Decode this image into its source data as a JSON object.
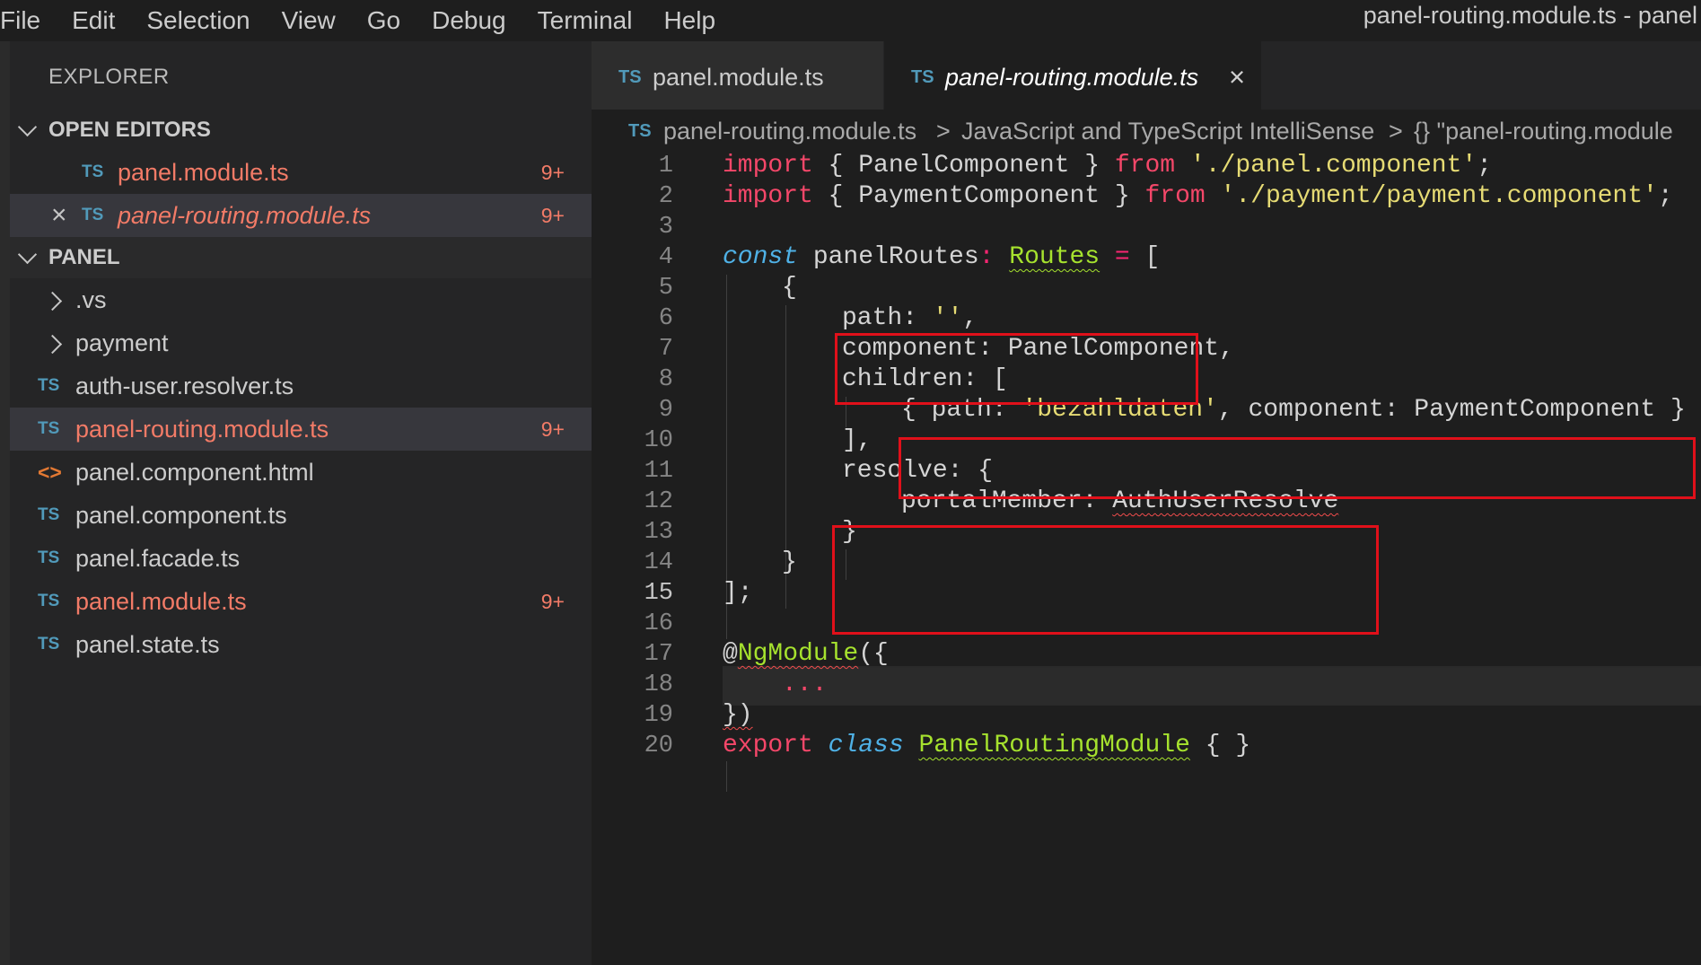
{
  "menu": [
    "File",
    "Edit",
    "Selection",
    "View",
    "Go",
    "Debug",
    "Terminal",
    "Help"
  ],
  "window_title": "panel-routing.module.ts - panel",
  "sidebar": {
    "title": "EXPLORER",
    "open_editors": {
      "header": "OPEN EDITORS",
      "items": [
        {
          "icon": "TS",
          "label": "panel.module.ts",
          "badge": "9+"
        },
        {
          "icon": "TS",
          "label": "panel-routing.module.ts",
          "badge": "9+"
        }
      ]
    },
    "panel": {
      "header": "PANEL",
      "items": [
        {
          "label": ".vs"
        },
        {
          "label": "payment"
        },
        {
          "icon": "TS",
          "label": "auth-user.resolver.ts"
        },
        {
          "icon": "TS",
          "label": "panel-routing.module.ts",
          "badge": "9+"
        },
        {
          "icon": "<>",
          "label": "panel.component.html"
        },
        {
          "icon": "TS",
          "label": "panel.component.ts"
        },
        {
          "icon": "TS",
          "label": "panel.facade.ts"
        },
        {
          "icon": "TS",
          "label": "panel.module.ts",
          "badge": "9+"
        },
        {
          "icon": "TS",
          "label": "panel.state.ts"
        }
      ]
    }
  },
  "tabs": [
    {
      "icon": "TS",
      "label": "panel.module.ts"
    },
    {
      "icon": "TS",
      "label": "panel-routing.module.ts",
      "active": true
    }
  ],
  "breadcrumb": {
    "icon": "TS",
    "file": "panel-routing.module.ts",
    "separator": ">",
    "part2": "JavaScript and TypeScript IntelliSense",
    "part3": "{} \"panel-routing.module"
  },
  "editor": {
    "current_line": 15,
    "line_numbers": [
      "1",
      "2",
      "3",
      "4",
      "5",
      "6",
      "7",
      "8",
      "9",
      "10",
      "11",
      "12",
      "13",
      "14",
      "15",
      "16",
      "17",
      "18",
      "19",
      "20"
    ],
    "code": {
      "l1": {
        "kw": "import",
        "a": " { PanelComponent } ",
        "kw2": "from",
        "sp": " ",
        "str": "'./panel.component'",
        "end": ";"
      },
      "l2": {
        "kw": "import",
        "a": " { PaymentComponent } ",
        "kw2": "from",
        "sp": " ",
        "str": "'./payment/payment.component'",
        "end": ";"
      },
      "l4": {
        "kw": "const",
        "a": " panelRoutes",
        "colon": ":",
        "sp": " ",
        "type": "Routes",
        "eq": " =",
        "end": " ["
      },
      "l5": "{",
      "l6": {
        "a": "path: ",
        "str": "''",
        "end": ","
      },
      "l7": "component: PanelComponent,",
      "l8": "children: [",
      "l9": {
        "a": "{ path: ",
        "str": "'bezahldaten'",
        "end": ", component: PaymentComponent }"
      },
      "l10": "],",
      "l11": "resolve: {",
      "l12": {
        "a": "portalMember: ",
        "err": "AuthUserResolve"
      },
      "l13": "}",
      "l14": "}",
      "l15": "];",
      "l17": {
        "at": "@",
        "type": "NgModule",
        "end": "({"
      },
      "l18": "...",
      "l19": {
        "err": "})"
      },
      "l20": {
        "kw": "export",
        "sp": " ",
        "kw2": "class",
        "sp2": " ",
        "type": "PanelRoutingModule",
        "end": " { }"
      }
    }
  },
  "colors": {
    "accent_box": "#e0101a",
    "modified_file": "#f27b67",
    "ts_icon": "#519aba"
  }
}
